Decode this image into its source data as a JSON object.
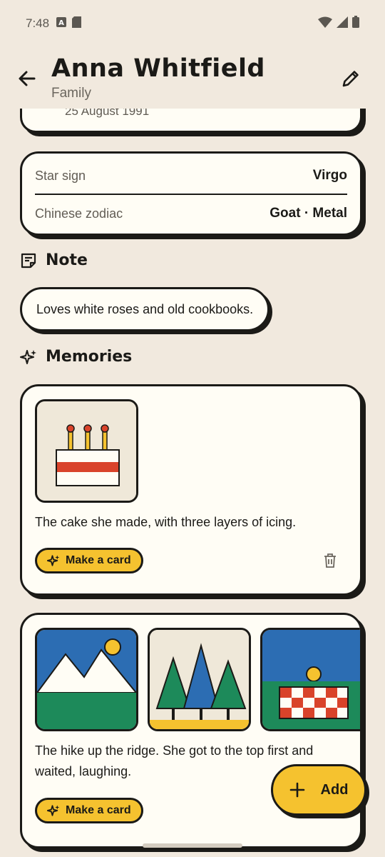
{
  "status_bar": {
    "time": "7:48"
  },
  "header": {
    "title": "Anna Whitfield",
    "subtitle": "Family"
  },
  "birthday": {
    "date": "25 August 1991"
  },
  "zodiac": {
    "star_sign_label": "Star sign",
    "star_sign_value": "Virgo",
    "chinese_label": "Chinese zodiac",
    "chinese_value": "Goat · Metal"
  },
  "note": {
    "heading": "Note",
    "text": "Loves white roses and old cookbooks."
  },
  "memories": {
    "heading": "Memories",
    "items": [
      {
        "text": "The cake she made, with three layers of icing.",
        "action_label": "Make a card"
      },
      {
        "text": "The hike up the ridge. She got to the top first and waited, laughing.",
        "action_label": "Make a card"
      }
    ]
  },
  "fab": {
    "label": "Add"
  },
  "colors": {
    "background": "#f1e9de",
    "card": "#fffdf5",
    "accent": "#f5c22f",
    "ink": "#1b1a17",
    "red": "#d9432a"
  }
}
